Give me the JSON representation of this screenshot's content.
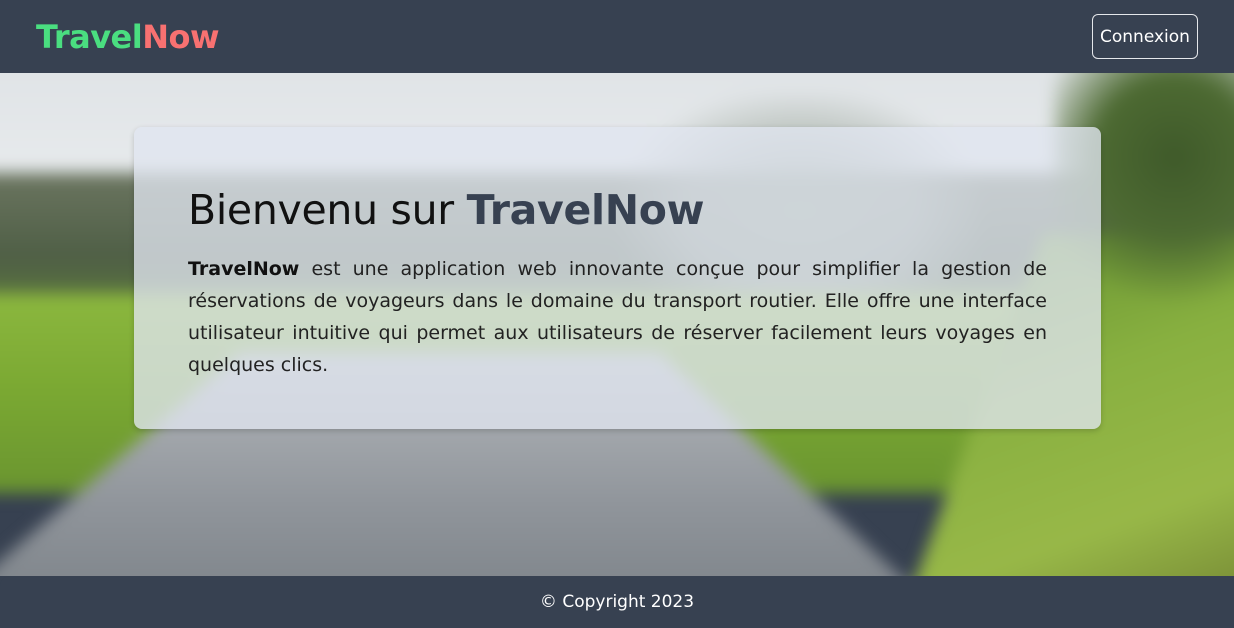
{
  "navbar": {
    "brand_part1": "Travel",
    "brand_part2": "Now",
    "login_label": "Connexion"
  },
  "hero": {
    "title_prefix": "Bienvenu sur ",
    "title_brand": "TravelNow",
    "description_brand": "TravelNow",
    "description_text": " est une application web innovante conçue pour simplifier la gestion de réservations de voyageurs dans le domaine du transport routier. Elle offre une interface utilisateur intuitive qui permet aux utilisateurs de réserver facilement leurs voyages en quelques clics."
  },
  "footer": {
    "copyright": "© Copyright 2023"
  },
  "colors": {
    "navbar_bg": "#374151",
    "brand_green": "#4ade80",
    "brand_red": "#f87171",
    "card_bg": "rgba(224,229,240,0.78)"
  }
}
